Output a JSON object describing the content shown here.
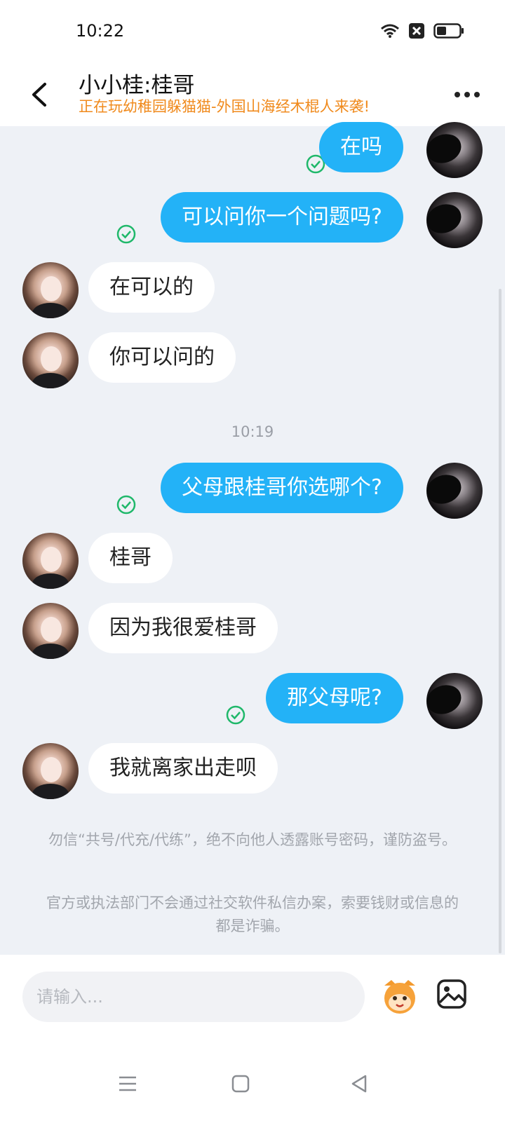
{
  "status_bar": {
    "time": "10:22"
  },
  "header": {
    "title": "小小桂:桂哥",
    "subtitle": "正在玩幼稚园躲猫猫-外国山海经木棍人来袭!"
  },
  "messages": [
    {
      "side": "out",
      "text": "在吗",
      "status": "read"
    },
    {
      "side": "out",
      "text": "可以问你一个问题吗?",
      "status": "read"
    },
    {
      "side": "in",
      "text": "在可以的"
    },
    {
      "side": "in",
      "text": "你可以问的"
    },
    {
      "side": "out",
      "text": "父母跟桂哥你选哪个?",
      "status": "read"
    },
    {
      "side": "in",
      "text": "桂哥"
    },
    {
      "side": "in",
      "text": "因为我很爱桂哥"
    },
    {
      "side": "out",
      "text": "那父母呢?",
      "status": "read"
    },
    {
      "side": "in",
      "text": "我就离家出走呗"
    }
  ],
  "timestamp": "10:19",
  "notices": [
    "勿信“共号/代充/代练”，绝不向他人透露账号密码，谨防盗号。",
    "官方或执法部门不会通过社交软件私信办案，索要钱财或信息的都是诈骗。"
  ],
  "input": {
    "placeholder": "请输入..."
  },
  "colors": {
    "outgoing_bubble": "#23b2f7",
    "incoming_bubble": "#ffffff",
    "subtitle": "#f08a1c",
    "read_check": "#1fb86a"
  }
}
